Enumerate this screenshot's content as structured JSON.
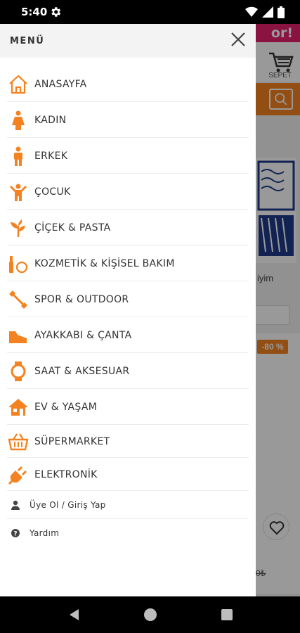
{
  "status": {
    "time": "5:40",
    "icons": [
      "gear-icon",
      "wifi-icon",
      "signal-icon",
      "battery-icon"
    ]
  },
  "background": {
    "promo_text": "or!",
    "cart_label": "SEPET",
    "snippet": "iyim",
    "discount": "-80 %",
    "price": "0₺"
  },
  "drawer": {
    "title": "MENÜ",
    "accent_color": "#f58220",
    "items": [
      {
        "label": "ANASAYFA",
        "icon": "home-icon"
      },
      {
        "label": "KADIN",
        "icon": "woman-icon"
      },
      {
        "label": "ERKEK",
        "icon": "man-icon"
      },
      {
        "label": "ÇOCUK",
        "icon": "child-icon"
      },
      {
        "label": "ÇİÇEK & PASTA",
        "icon": "plant-icon"
      },
      {
        "label": "KOZMETİK & KİŞİSEL BAKIM",
        "icon": "cosmetics-icon"
      },
      {
        "label": "SPOR & OUTDOOR",
        "icon": "dumbbell-icon"
      },
      {
        "label": "AYAKKABI & ÇANTA",
        "icon": "shoe-icon"
      },
      {
        "label": "SAAT & AKSESUAR",
        "icon": "watch-icon"
      },
      {
        "label": "EV & YAŞAM",
        "icon": "house-icon"
      },
      {
        "label": "SÜPERMARKET",
        "icon": "basket-icon"
      },
      {
        "label": "ELEKTRONİK",
        "icon": "plug-icon"
      }
    ],
    "account": [
      {
        "label": "Üye Ol / Giriş Yap",
        "icon": "user-icon"
      },
      {
        "label": "Yardım",
        "icon": "help-icon"
      }
    ]
  }
}
